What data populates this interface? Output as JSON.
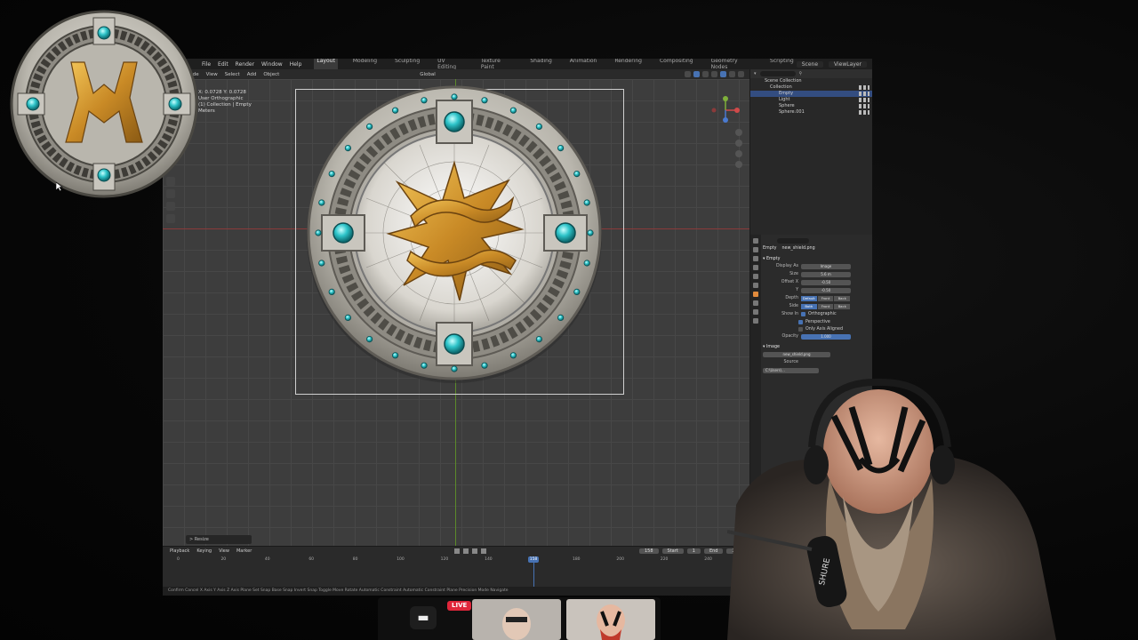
{
  "app": {
    "menu": [
      "File",
      "Edit",
      "Render",
      "Window",
      "Help"
    ],
    "workspaces": [
      "Layout",
      "Modeling",
      "Sculpting",
      "UV Editing",
      "Texture Paint",
      "Shading",
      "Animation",
      "Rendering",
      "Compositing",
      "Geometry Nodes",
      "Scripting"
    ],
    "active_workspace": "Layout",
    "scene_label": "Scene",
    "view_layer_label": "ViewLayer"
  },
  "viewport": {
    "mode": "Object Mode",
    "menus": [
      "View",
      "Select",
      "Add",
      "Object"
    ],
    "transform": "Global",
    "info_lines": [
      "User Orthographic",
      "(1) Collection | Empty",
      "Meters"
    ],
    "operator_panel": "> Resize",
    "coords": "X: 0.0728  Y: 0.0728"
  },
  "outliner": {
    "root": "Scene Collection",
    "collection": "Collection",
    "items": [
      "Empty",
      "Light",
      "Sphere",
      "Sphere.001"
    ],
    "selected": "Empty"
  },
  "properties": {
    "crumb_object": "Empty",
    "crumb_image": "new_shield.png",
    "section_empty": "Empty",
    "display_as_label": "Display As",
    "display_as_value": "Image",
    "size_label": "Size",
    "size_value": "5.6 m",
    "offset_x_label": "Offset X",
    "offset_x_value": "-0.50",
    "offset_y_label": "Y",
    "offset_y_value": "-0.50",
    "depth_label": "Depth",
    "depth_options": [
      "Default",
      "Front",
      "Back"
    ],
    "side_label": "Side",
    "side_options": [
      "Both",
      "Front",
      "Back"
    ],
    "show_in_label": "Show In",
    "show_options": [
      "Orthographic",
      "Perspective",
      "Only Axis Aligned"
    ],
    "opacity_label": "Opacity",
    "opacity_value": "1.000",
    "section_image": "Image",
    "image_name": "new_shield.png",
    "source_label": "Source",
    "path": "C:\\Users\\..."
  },
  "timeline": {
    "menus": [
      "Playback",
      "Keying",
      "View",
      "Marker"
    ],
    "current_frame": "158",
    "start_label": "Start",
    "start_value": "1",
    "end_label": "End",
    "end_value": "250",
    "ticks": [
      "0",
      "10",
      "20",
      "30",
      "40",
      "50",
      "60",
      "70",
      "80",
      "90",
      "100",
      "110",
      "120",
      "130",
      "140",
      "150",
      "160",
      "170",
      "180",
      "190",
      "200",
      "210",
      "220",
      "230",
      "240",
      "250"
    ]
  },
  "status_bar": "Confirm  Cancel  X Axis  Y Axis  Z Axis  Plane  Set Snap Base  Snap Invert  Snap Toggle  Move  Rotate  Automatic Constraint  Automatic Constraint Plane  Precision Mode  Navigate",
  "taskbar": {
    "live_badge": "LIVE"
  },
  "colors": {
    "blender_accent": "#4772b3",
    "shield_gold": "#d9a03a",
    "shield_gem": "#2ec4c9",
    "live_red": "#e0263a"
  }
}
